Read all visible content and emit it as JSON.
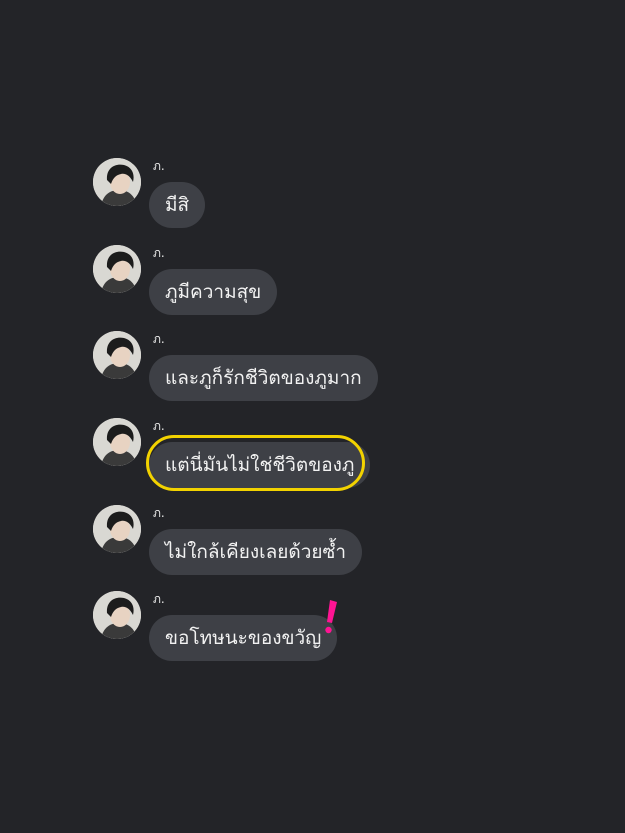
{
  "chat": {
    "messages": [
      {
        "sender": "ภ.",
        "text": "มีสิ"
      },
      {
        "sender": "ภ.",
        "text": "ภูมีความสุข"
      },
      {
        "sender": "ภ.",
        "text": "และภูก็รักชีวิตของภูมาก"
      },
      {
        "sender": "ภ.",
        "text": "แต่นี่มันไม่ใช่ชีวิตของภู"
      },
      {
        "sender": "ภ.",
        "text": "ไม่ใกล้เคียงเลยด้วยซ้ำ"
      },
      {
        "sender": "ภ.",
        "text": "ขอโทษนะของขวัญ"
      }
    ]
  },
  "colors": {
    "background": "#232428",
    "bubble": "#3e4046",
    "highlight": "#f2d200",
    "exclamation": "#ff1493"
  },
  "icons": {
    "avatar": "avatar-photo-icon",
    "annotation": "exclamation-mark-icon"
  }
}
